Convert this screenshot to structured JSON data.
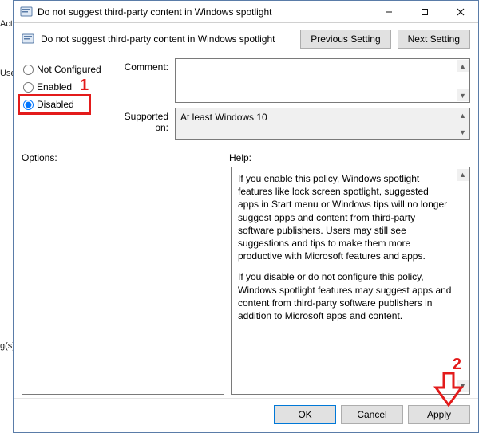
{
  "bg": {
    "act": "Acti",
    "use": "Use",
    "g_s": "g(s)"
  },
  "window": {
    "title": "Do not suggest third-party content in Windows spotlight"
  },
  "header": {
    "title": "Do not suggest third-party content in Windows spotlight",
    "prev": "Previous Setting",
    "next": "Next Setting"
  },
  "radios": {
    "not_configured": "Not Configured",
    "enabled": "Enabled",
    "disabled": "Disabled",
    "selected": "disabled"
  },
  "fields": {
    "comment_label": "Comment:",
    "supported_label": "Supported on:",
    "supported_value": "At least Windows 10"
  },
  "labels": {
    "options": "Options:",
    "help": "Help:"
  },
  "help": {
    "p1": "If you enable this policy, Windows spotlight features like lock screen spotlight, suggested apps in Start menu or Windows tips will no longer suggest apps and content from third-party software publishers. Users may still see suggestions and tips to make them more productive with Microsoft features and apps.",
    "p2": "If you disable or do not configure this policy, Windows spotlight features may suggest apps and content from third-party software publishers in addition to Microsoft apps and content."
  },
  "buttons": {
    "ok": "OK",
    "cancel": "Cancel",
    "apply": "Apply"
  },
  "annotations": {
    "one": "1",
    "two": "2"
  }
}
